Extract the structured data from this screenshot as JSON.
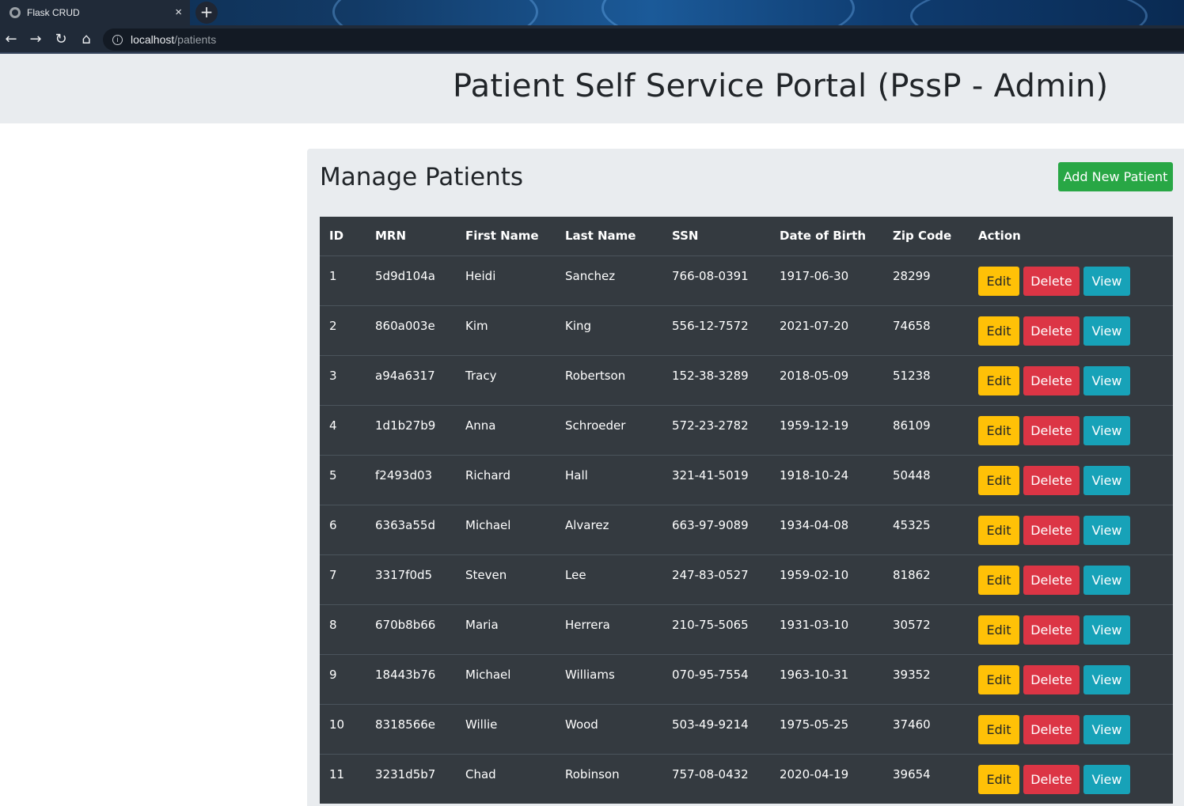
{
  "browser": {
    "tab_title": "Flask CRUD",
    "tab_close": "×",
    "new_tab": "+",
    "url_host": "localhost",
    "url_path": "/patients",
    "nav": {
      "back": "←",
      "forward": "→",
      "reload": "↻",
      "home": "⌂"
    },
    "info_icon": "i"
  },
  "header": {
    "title": "Patient Self Service Portal (PssP - Admin)"
  },
  "main": {
    "heading": "Manage Patients",
    "add_button_label": "Add New Patient",
    "columns": [
      "ID",
      "MRN",
      "First Name",
      "Last Name",
      "SSN",
      "Date of Birth",
      "Zip Code",
      "Action"
    ],
    "action_labels": {
      "edit": "Edit",
      "delete": "Delete",
      "view": "View"
    },
    "rows": [
      {
        "id": "1",
        "mrn": "5d9d104a",
        "first": "Heidi",
        "last": "Sanchez",
        "ssn": "766-08-0391",
        "dob": "1917-06-30",
        "zip": "28299"
      },
      {
        "id": "2",
        "mrn": "860a003e",
        "first": "Kim",
        "last": "King",
        "ssn": "556-12-7572",
        "dob": "2021-07-20",
        "zip": "74658"
      },
      {
        "id": "3",
        "mrn": "a94a6317",
        "first": "Tracy",
        "last": "Robertson",
        "ssn": "152-38-3289",
        "dob": "2018-05-09",
        "zip": "51238"
      },
      {
        "id": "4",
        "mrn": "1d1b27b9",
        "first": "Anna",
        "last": "Schroeder",
        "ssn": "572-23-2782",
        "dob": "1959-12-19",
        "zip": "86109"
      },
      {
        "id": "5",
        "mrn": "f2493d03",
        "first": "Richard",
        "last": "Hall",
        "ssn": "321-41-5019",
        "dob": "1918-10-24",
        "zip": "50448"
      },
      {
        "id": "6",
        "mrn": "6363a55d",
        "first": "Michael",
        "last": "Alvarez",
        "ssn": "663-97-9089",
        "dob": "1934-04-08",
        "zip": "45325"
      },
      {
        "id": "7",
        "mrn": "3317f0d5",
        "first": "Steven",
        "last": "Lee",
        "ssn": "247-83-0527",
        "dob": "1959-02-10",
        "zip": "81862"
      },
      {
        "id": "8",
        "mrn": "670b8b66",
        "first": "Maria",
        "last": "Herrera",
        "ssn": "210-75-5065",
        "dob": "1931-03-10",
        "zip": "30572"
      },
      {
        "id": "9",
        "mrn": "18443b76",
        "first": "Michael",
        "last": "Williams",
        "ssn": "070-95-7554",
        "dob": "1963-10-31",
        "zip": "39352"
      },
      {
        "id": "10",
        "mrn": "8318566e",
        "first": "Willie",
        "last": "Wood",
        "ssn": "503-49-9214",
        "dob": "1975-05-25",
        "zip": "37460"
      },
      {
        "id": "11",
        "mrn": "3231d5b7",
        "first": "Chad",
        "last": "Robinson",
        "ssn": "757-08-0432",
        "dob": "2020-04-19",
        "zip": "39654"
      }
    ]
  },
  "colors": {
    "jumbotron_bg": "#e9ecef",
    "table_bg": "#343a40",
    "success": "#28a745",
    "warning": "#ffc107",
    "danger": "#dc3545",
    "info": "#17a2b8"
  }
}
